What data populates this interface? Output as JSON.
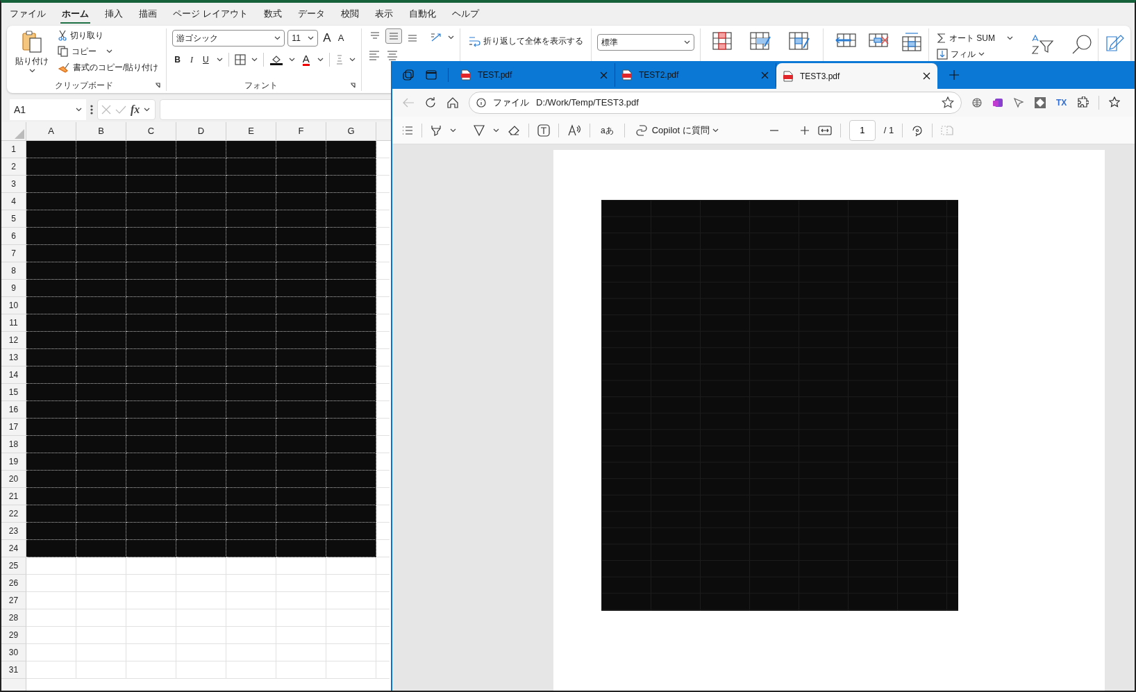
{
  "excel": {
    "menu_tabs": [
      {
        "label": "ファイル",
        "selected": false
      },
      {
        "label": "ホーム",
        "selected": true
      },
      {
        "label": "挿入",
        "selected": false
      },
      {
        "label": "描画",
        "selected": false
      },
      {
        "label": "ページ レイアウト",
        "selected": false
      },
      {
        "label": "数式",
        "selected": false
      },
      {
        "label": "データ",
        "selected": false
      },
      {
        "label": "校閲",
        "selected": false
      },
      {
        "label": "表示",
        "selected": false
      },
      {
        "label": "自動化",
        "selected": false
      },
      {
        "label": "ヘルプ",
        "selected": false
      }
    ],
    "clipboard": {
      "paste": "貼り付け",
      "cut": "切り取り",
      "copy": "コピー",
      "format_painter": "書式のコピー/貼り付け",
      "group_label": "クリップボード"
    },
    "font": {
      "name": "游ゴシック",
      "size": "11",
      "grow": "A",
      "shrink": "A",
      "bold": "B",
      "italic": "I",
      "underline": "U",
      "color_letter": "A",
      "group_label": "フォント"
    },
    "wrap_text": "折り返して全体を表示する",
    "number_format": "標準",
    "autosum": "オート SUM",
    "fill": "フィル",
    "name_box": "A1",
    "fx": "fx",
    "columns": [
      "A",
      "B",
      "C",
      "D",
      "E",
      "F",
      "G"
    ],
    "rows": [
      {
        "label": "1",
        "filled": true
      },
      {
        "label": "2",
        "filled": true
      },
      {
        "label": "3",
        "filled": true
      },
      {
        "label": "4",
        "filled": true
      },
      {
        "label": "5",
        "filled": true
      },
      {
        "label": "6",
        "filled": true
      },
      {
        "label": "7",
        "filled": true
      },
      {
        "label": "8",
        "filled": true
      },
      {
        "label": "9",
        "filled": true
      },
      {
        "label": "10",
        "filled": true
      },
      {
        "label": "11",
        "filled": true
      },
      {
        "label": "12",
        "filled": true
      },
      {
        "label": "13",
        "filled": true
      },
      {
        "label": "14",
        "filled": true
      },
      {
        "label": "15",
        "filled": true
      },
      {
        "label": "16",
        "filled": true
      },
      {
        "label": "17",
        "filled": true
      },
      {
        "label": "18",
        "filled": true
      },
      {
        "label": "19",
        "filled": true
      },
      {
        "label": "20",
        "filled": true
      },
      {
        "label": "21",
        "filled": true
      },
      {
        "label": "22",
        "filled": true
      },
      {
        "label": "23",
        "filled": true
      },
      {
        "label": "24",
        "filled": true
      },
      {
        "label": "25",
        "filled": false
      },
      {
        "label": "26",
        "filled": false
      },
      {
        "label": "27",
        "filled": false
      },
      {
        "label": "28",
        "filled": false
      },
      {
        "label": "29",
        "filled": false
      },
      {
        "label": "30",
        "filled": false
      },
      {
        "label": "31",
        "filled": false
      }
    ]
  },
  "browser": {
    "tabs": [
      {
        "title": "TEST.pdf",
        "selected": false
      },
      {
        "title": "TEST2.pdf",
        "selected": false
      },
      {
        "title": "TEST3.pdf",
        "selected": true
      }
    ],
    "address": {
      "scheme_label": "ファイル",
      "url": "D:/Work/Temp/TEST3.pdf"
    },
    "extension_label": "TX",
    "pdf_toolbar": {
      "translate": "aあ",
      "copilot": "Copilot に質問",
      "page": "1",
      "page_total": "/ 1"
    }
  }
}
